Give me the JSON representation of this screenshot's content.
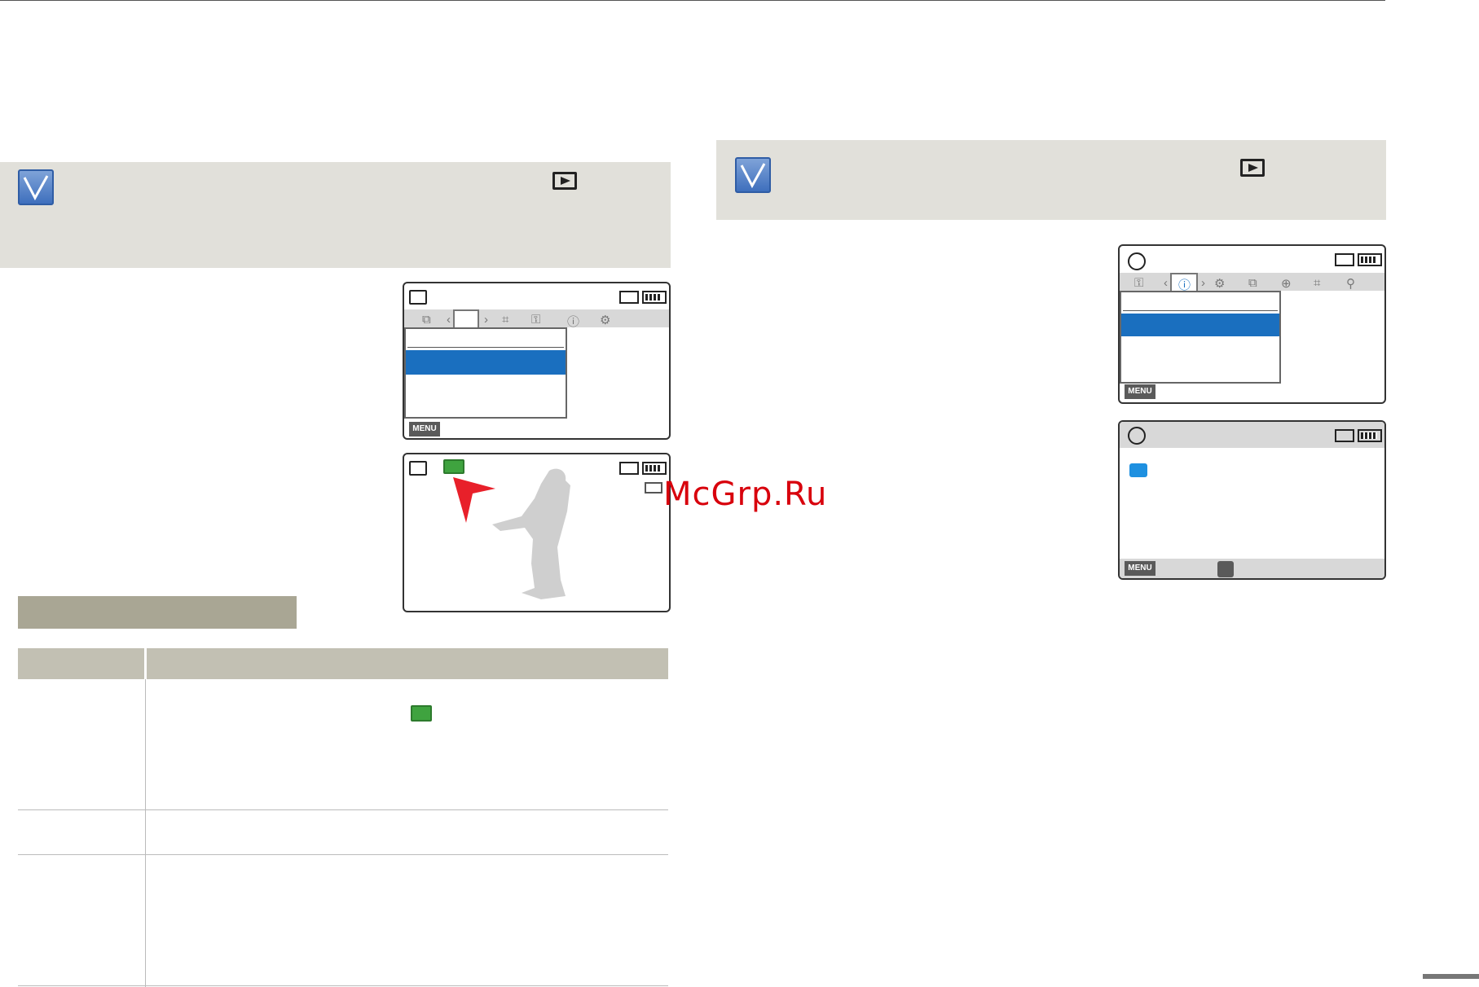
{
  "watermark": "McGrp.Ru",
  "screens": {
    "menu_label": "MENU"
  },
  "icons": {
    "note": "checkmark-note-icon",
    "play_mode": "play-mode-icon",
    "tab_glyphs_left": [
      "⧉",
      "⌗",
      "⚿",
      "ⓘ",
      "⚙"
    ],
    "tab_glyphs_right": [
      "⚿",
      "ⓘ",
      "⚙",
      "⧉",
      "⊕",
      "⌗",
      "⚲"
    ]
  },
  "colors": {
    "note_bg": "#e1e0da",
    "selected_row": "#1a6fbf",
    "section_bar": "#a9a694",
    "table_head": "#c2c0b3",
    "watermark": "#d8000c"
  }
}
